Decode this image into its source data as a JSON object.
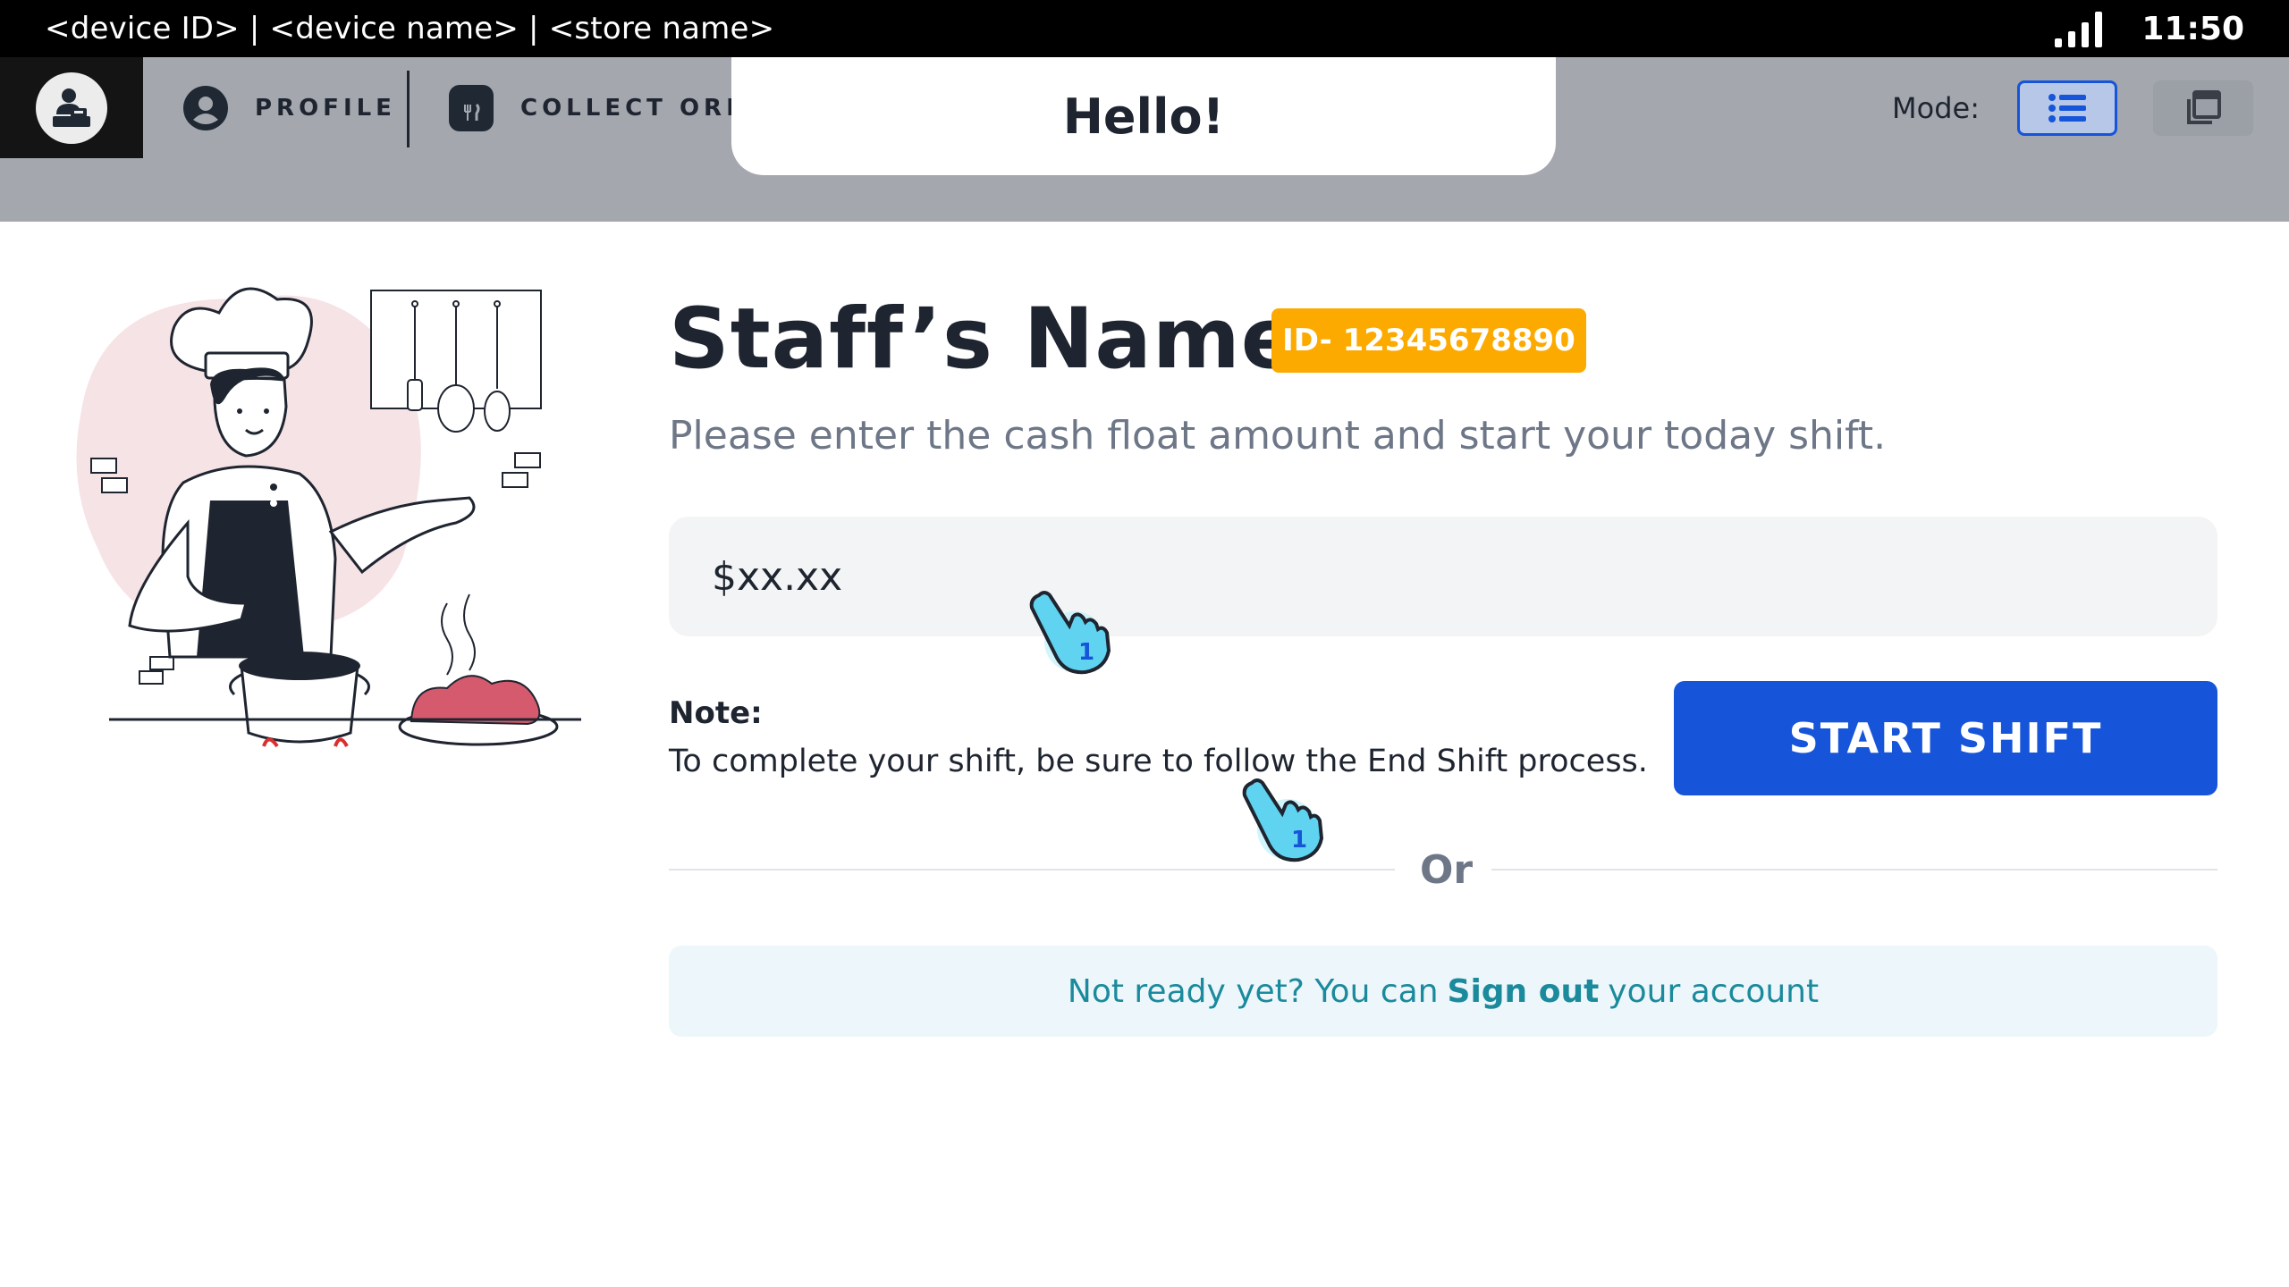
{
  "status_bar": {
    "device_info": "<device ID> | <device name> | <store name>",
    "time": "11:50",
    "signal_icon": "signal-bars-icon"
  },
  "nav": {
    "home_icon": "cashier-icon",
    "items": [
      {
        "label": "PROFILE",
        "icon": "user-circle-icon"
      },
      {
        "label": "COLLECT ORDE",
        "icon": "store-icon"
      }
    ],
    "mode_label": "Mode:",
    "mode_options": [
      {
        "icon": "list-icon",
        "active": true
      },
      {
        "icon": "multi-window-icon",
        "active": false
      }
    ]
  },
  "toast": {
    "message": "Hello!"
  },
  "main": {
    "staff_name": "Staff’s Name",
    "id_badge": "ID- 12345678890",
    "instruction": "Please enter the cash float amount and start your today shift.",
    "amount_placeholder": "$xx.xx",
    "note_title": "Note:",
    "note_text": "To complete your shift, be sure to follow the End Shift process.",
    "start_button": "START SHIFT",
    "divider_text": "Or",
    "signout_prefix": "Not ready yet? You can",
    "signout_link": "Sign out",
    "signout_suffix": "your account"
  },
  "hints": [
    {
      "icon": "tap-hand-icon",
      "number": "1"
    },
    {
      "icon": "tap-hand-icon",
      "number": "1"
    }
  ],
  "colors": {
    "primary": "#1654d9",
    "badge": "#fdaa00",
    "link": "#1b8a9c",
    "nav_bg": "#a4a8ae"
  }
}
